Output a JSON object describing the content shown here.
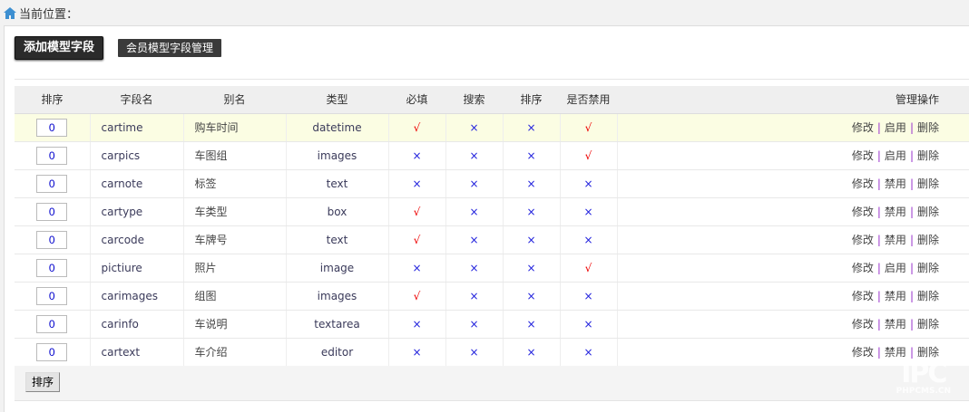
{
  "breadcrumb": {
    "label": "当前位置："
  },
  "buttons": {
    "add": "添加模型字段",
    "member": "会员模型字段管理",
    "sort": "排序"
  },
  "columns": [
    "排序",
    "字段名",
    "别名",
    "类型",
    "必填",
    "搜索",
    "排序",
    "是否禁用",
    "管理操作"
  ],
  "marks": {
    "yes": "√",
    "no": "×"
  },
  "ops": {
    "edit": "修改",
    "enable": "启用",
    "disable": "禁用",
    "delete": "删除",
    "sep": "|"
  },
  "rows": [
    {
      "order": "0",
      "field": "cartime",
      "alias": "购车时间",
      "type": "datetime",
      "required": true,
      "search": false,
      "sort": false,
      "disabled": true
    },
    {
      "order": "0",
      "field": "carpics",
      "alias": "车图组",
      "type": "images",
      "required": false,
      "search": false,
      "sort": false,
      "disabled": true
    },
    {
      "order": "0",
      "field": "carnote",
      "alias": "标签",
      "type": "text",
      "required": false,
      "search": false,
      "sort": false,
      "disabled": false
    },
    {
      "order": "0",
      "field": "cartype",
      "alias": "车类型",
      "type": "box",
      "required": true,
      "search": false,
      "sort": false,
      "disabled": false
    },
    {
      "order": "0",
      "field": "carcode",
      "alias": "车牌号",
      "type": "text",
      "required": true,
      "search": false,
      "sort": false,
      "disabled": false
    },
    {
      "order": "0",
      "field": "pictiure",
      "alias": "照片",
      "type": "image",
      "required": false,
      "search": false,
      "sort": false,
      "disabled": true
    },
    {
      "order": "0",
      "field": "carimages",
      "alias": "组图",
      "type": "images",
      "required": true,
      "search": false,
      "sort": false,
      "disabled": false
    },
    {
      "order": "0",
      "field": "carinfo",
      "alias": "车说明",
      "type": "textarea",
      "required": false,
      "search": false,
      "sort": false,
      "disabled": false
    },
    {
      "order": "0",
      "field": "cartext",
      "alias": "车介绍",
      "type": "editor",
      "required": false,
      "search": false,
      "sort": false,
      "disabled": false
    }
  ],
  "watermark": "PHPCMS.CN",
  "colors": {
    "highlight_row": "#fbfde3",
    "check": "#ee0000",
    "cross": "#2222dd"
  }
}
